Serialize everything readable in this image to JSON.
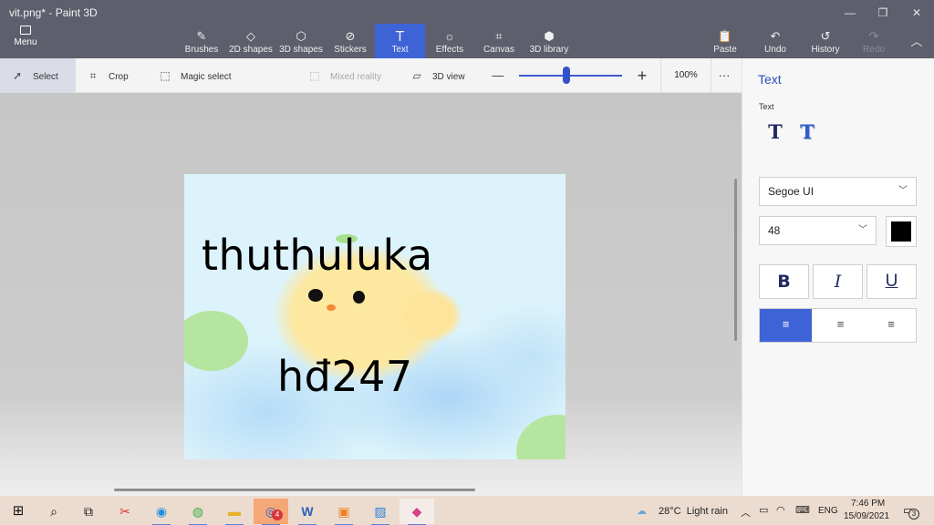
{
  "window": {
    "title": "vit.png* - Paint 3D",
    "controls": [
      "minimize-icon",
      "maximize-icon",
      "close-icon"
    ]
  },
  "ribbon": {
    "menu_label": "Menu",
    "tools": [
      {
        "label": "Brushes",
        "icon": "brush-icon"
      },
      {
        "label": "2D shapes",
        "icon": "2d-shapes-icon"
      },
      {
        "label": "3D shapes",
        "icon": "3d-shapes-icon"
      },
      {
        "label": "Stickers",
        "icon": "stickers-icon"
      },
      {
        "label": "Text",
        "icon": "text-icon",
        "active": true
      },
      {
        "label": "Effects",
        "icon": "effects-icon"
      },
      {
        "label": "Canvas",
        "icon": "canvas-icon"
      },
      {
        "label": "3D library",
        "icon": "3d-library-icon"
      }
    ],
    "right_tools": [
      {
        "label": "Paste",
        "icon": "paste-icon"
      },
      {
        "label": "Undo",
        "icon": "undo-icon"
      },
      {
        "label": "History",
        "icon": "history-icon"
      },
      {
        "label": "Redo",
        "icon": "redo-icon",
        "disabled": true
      }
    ]
  },
  "subbar": {
    "select_label": "Select",
    "crop_label": "Crop",
    "magic_select_label": "Magic select",
    "mixed_reality_label": "Mixed reality",
    "view3d_label": "3D view",
    "zoom_out": "—",
    "zoom_in": "+",
    "zoom_level": "100%",
    "zoom_fraction": 0.46,
    "more": "···"
  },
  "canvas": {
    "text_top": "thuthuluka",
    "text_bottom": "hđ247"
  },
  "panel": {
    "title": "Text",
    "subtitle": "Text",
    "font": "Segoe UI",
    "size": "48",
    "color": "#000000",
    "bold": "B",
    "italic": "I",
    "underline": "U"
  },
  "taskbar": {
    "weather_temp": "28°C",
    "weather_desc": "Light rain",
    "language": "ENG",
    "time": "7:46 PM",
    "date": "15/09/2021",
    "zalo_badge": "4",
    "notification_count": "3"
  },
  "colors": {
    "ribbon": "#5e5f6c",
    "accent": "#3e63d6",
    "canvas_bg": "#dcf3fb",
    "duck": "#fde8a0",
    "leaf": "#b8e6a4"
  }
}
